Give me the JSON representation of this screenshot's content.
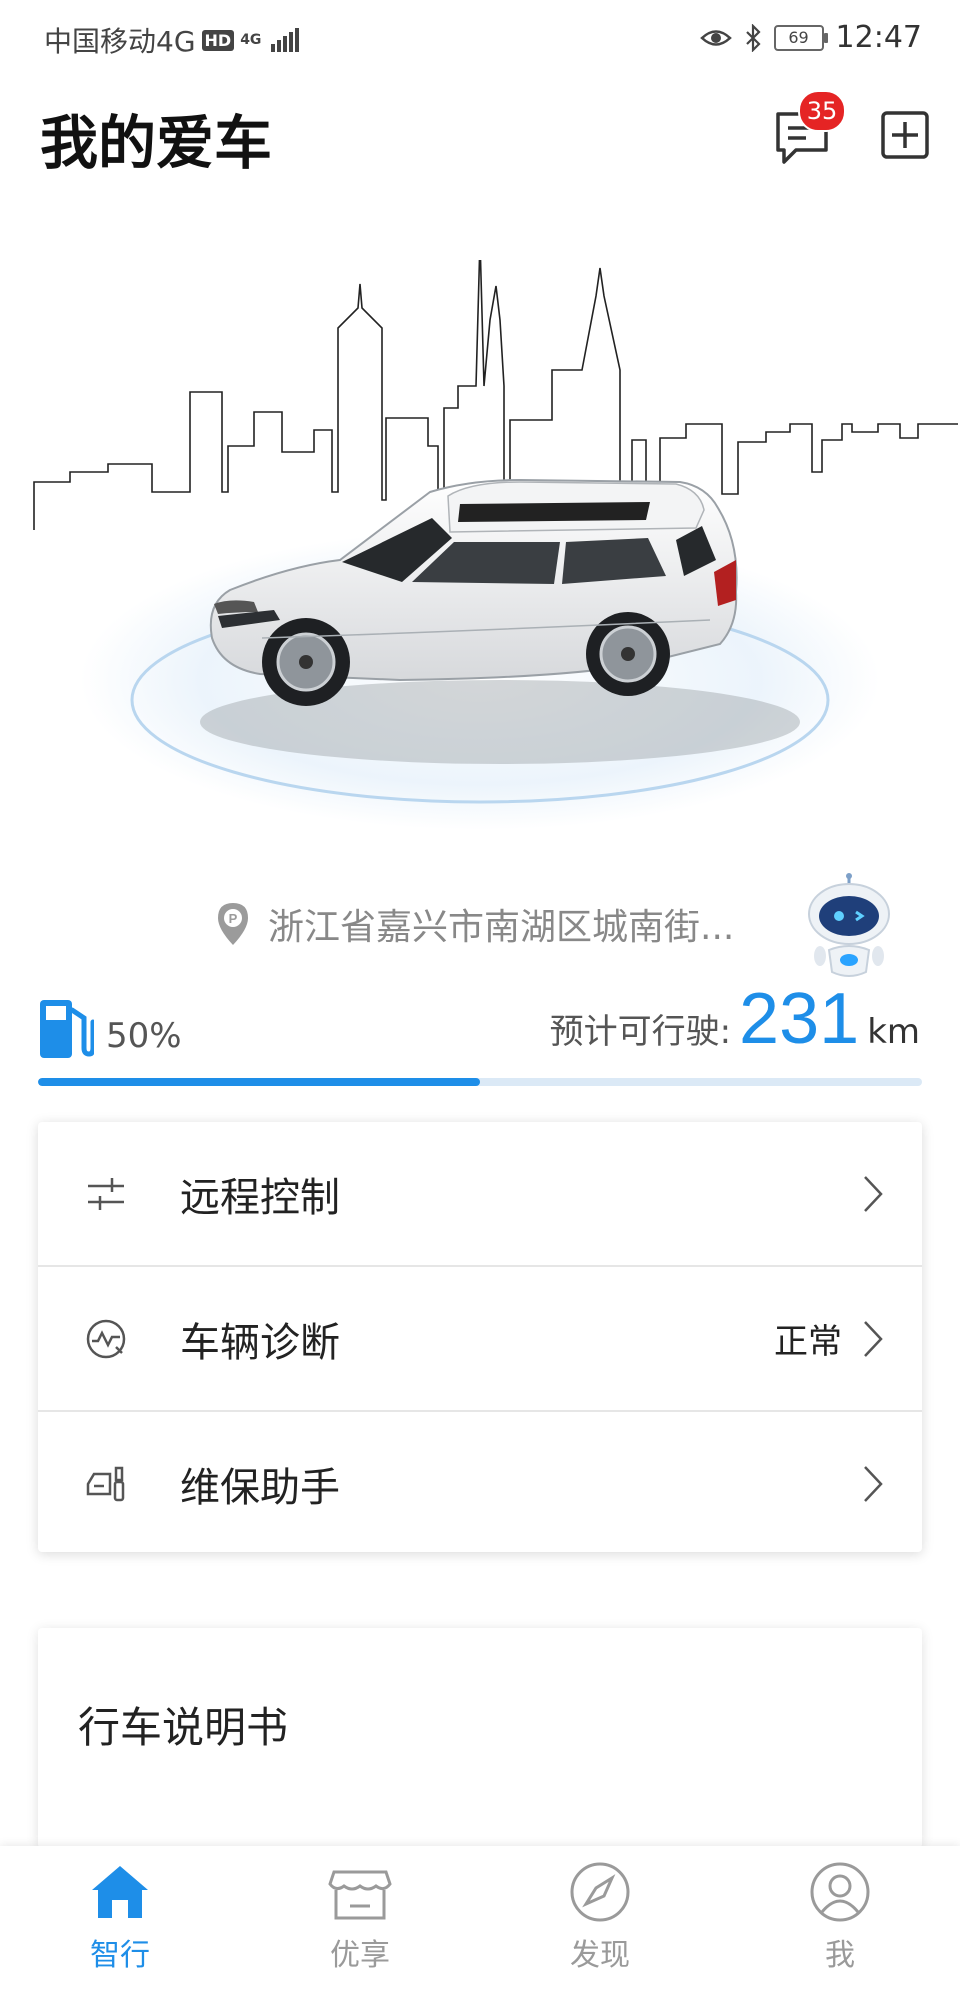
{
  "status_bar": {
    "carrier": "中国移动4G",
    "hd": "HD",
    "network": "4G",
    "battery": "69",
    "time": "12:47"
  },
  "header": {
    "title": "我的爱车",
    "message_badge": "35"
  },
  "vehicle": {
    "location": "浙江省嘉兴市南湖区城南街...",
    "fuel_percent_label": "50%",
    "fuel_level": 0.5,
    "range_label": "预计可行驶:",
    "range_value": "231",
    "range_unit": "km"
  },
  "menu": {
    "items": [
      {
        "label": "远程控制",
        "status": ""
      },
      {
        "label": "车辆诊断",
        "status": "正常"
      },
      {
        "label": "维保助手",
        "status": ""
      }
    ]
  },
  "manual": {
    "title": "行车说明书"
  },
  "tabs": [
    {
      "label": "智行",
      "icon": "home-icon",
      "active": true
    },
    {
      "label": "优享",
      "icon": "store-icon",
      "active": false
    },
    {
      "label": "发现",
      "icon": "compass-icon",
      "active": false
    },
    {
      "label": "我",
      "icon": "user-icon",
      "active": false
    }
  ],
  "colors": {
    "accent": "#1e8ee8",
    "badge": "#e52424"
  }
}
